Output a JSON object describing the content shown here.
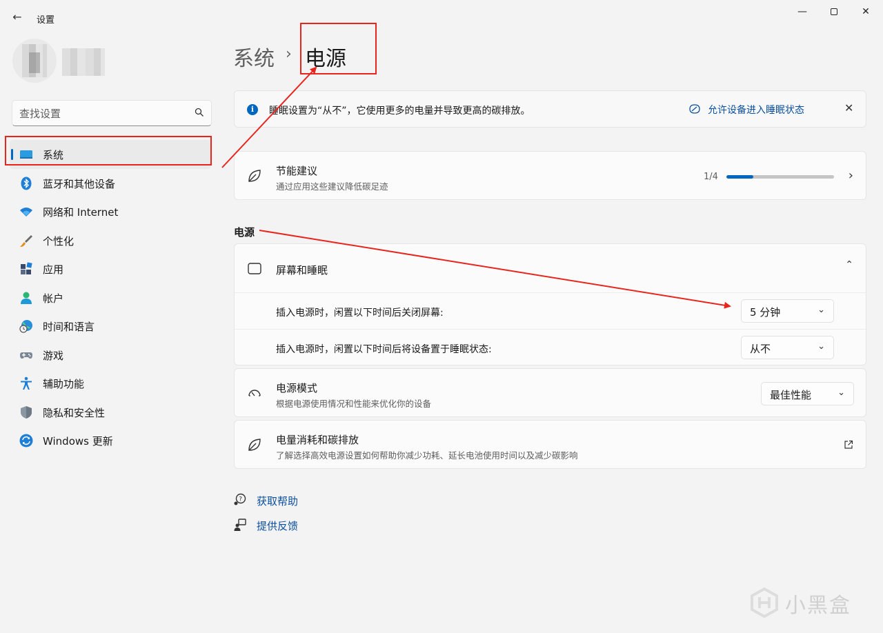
{
  "window": {
    "app_title": "设置",
    "back_glyph": "←",
    "minimize_glyph": "—",
    "close_glyph": "✕"
  },
  "search": {
    "placeholder": "查找设置"
  },
  "sidebar": {
    "items": [
      {
        "label": "系统",
        "icon": "system-display-icon",
        "active": true
      },
      {
        "label": "蓝牙和其他设备",
        "icon": "bluetooth-icon"
      },
      {
        "label": "网络和 Internet",
        "icon": "wifi-icon"
      },
      {
        "label": "个性化",
        "icon": "brush-icon"
      },
      {
        "label": "应用",
        "icon": "apps-icon"
      },
      {
        "label": "帐户",
        "icon": "account-icon"
      },
      {
        "label": "时间和语言",
        "icon": "globe-clock-icon"
      },
      {
        "label": "游戏",
        "icon": "gamepad-icon"
      },
      {
        "label": "辅助功能",
        "icon": "accessibility-icon"
      },
      {
        "label": "隐私和安全性",
        "icon": "shield-icon"
      },
      {
        "label": "Windows 更新",
        "icon": "update-icon"
      }
    ]
  },
  "breadcrumb": {
    "parent": "系统",
    "separator": "›",
    "current": "电源"
  },
  "info_bar": {
    "text": "睡眠设置为“从不”，它使用更多的电量并导致更高的碳排放。",
    "link": "允许设备进入睡眠状态",
    "close_glyph": "✕"
  },
  "energy_recommendations": {
    "title": "节能建议",
    "subtitle": "通过应用这些建议降低碳足迹",
    "progress_text": "1/4",
    "progress_fraction": 0.25
  },
  "power_section": {
    "title": "电源",
    "screen_sleep": {
      "title": "屏幕和睡眠",
      "expanded": true,
      "rows": [
        {
          "label": "插入电源时，闲置以下时间后关闭屏幕:",
          "value": "5 分钟"
        },
        {
          "label": "插入电源时，闲置以下时间后将设备置于睡眠状态:",
          "value": "从不"
        }
      ]
    },
    "power_mode": {
      "title": "电源模式",
      "subtitle": "根据电源使用情况和性能来优化你的设备",
      "value": "最佳性能"
    },
    "consumption": {
      "title": "电量消耗和碳排放",
      "subtitle": "了解选择高效电源设置如何帮助你减少功耗、延长电池使用时间以及减少碳影响"
    }
  },
  "help_links": {
    "get_help": "获取帮助",
    "feedback": "提供反馈"
  },
  "watermark": {
    "text": "小黑盒"
  },
  "colors": {
    "accent": "#0067c0",
    "annotation_red": "#e8241c",
    "link": "#0a4f9e"
  }
}
